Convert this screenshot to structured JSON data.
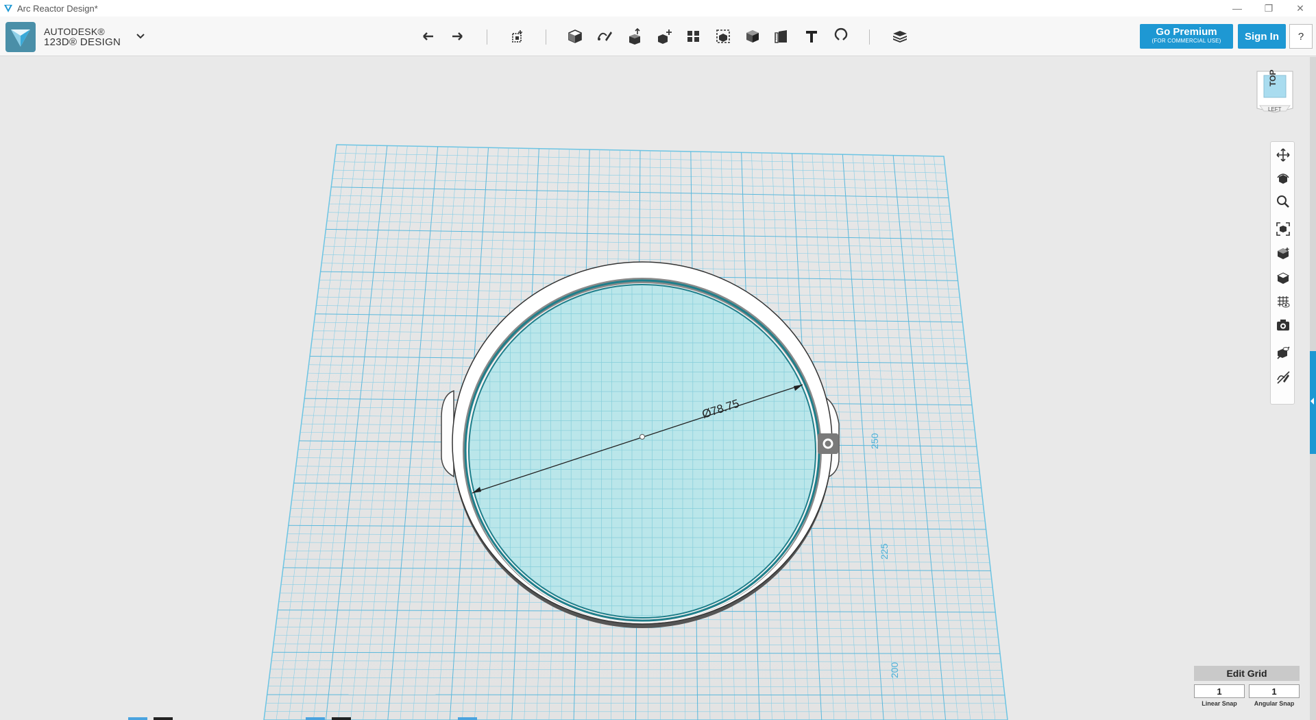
{
  "window": {
    "title": "Arc Reactor Design*",
    "controls": {
      "minimize": "—",
      "restore": "❐",
      "close": "✕"
    }
  },
  "brand": {
    "line1": "AUTODESK®",
    "line2": "123D® DESIGN",
    "menu_icon": "chevron-down-icon"
  },
  "toolbar": {
    "tools": [
      "undo-icon",
      "redo-icon",
      "transform-icon",
      "primitives-icon",
      "sketch-icon",
      "construct-icon",
      "modify-icon",
      "pattern-icon",
      "grouping-icon",
      "combine-icon",
      "measure-icon",
      "text-icon",
      "snap-icon",
      "material-icon"
    ]
  },
  "account": {
    "premium_label": "Go Premium",
    "premium_sub": "(FOR COMMERCIAL USE)",
    "signin_label": "Sign In",
    "help_label": "?"
  },
  "viewcube": {
    "face": "TOP",
    "side_face": "LEFT"
  },
  "navbar": {
    "buttons": [
      "pan-icon",
      "orbit-icon",
      "zoom-icon",
      "fit-icon",
      "view-shaded-icon",
      "view-material-icon",
      "grid-visibility-icon",
      "camera-icon",
      "hide-materials-icon",
      "hide-sketches-icon"
    ]
  },
  "scene": {
    "dimension_label": "Ø78.75",
    "ruler_labels": [
      "250",
      "225",
      "200"
    ],
    "colors": {
      "accent": "#1e98d3",
      "grid": "#62c3e4",
      "disk_fill": "#b4e4e8",
      "disk_edge": "#1f7f8b"
    }
  },
  "edit_grid": {
    "header": "Edit Grid",
    "linear_value": "1",
    "angular_value": "1",
    "linear_label": "Linear Snap",
    "angular_label": "Angular Snap"
  }
}
